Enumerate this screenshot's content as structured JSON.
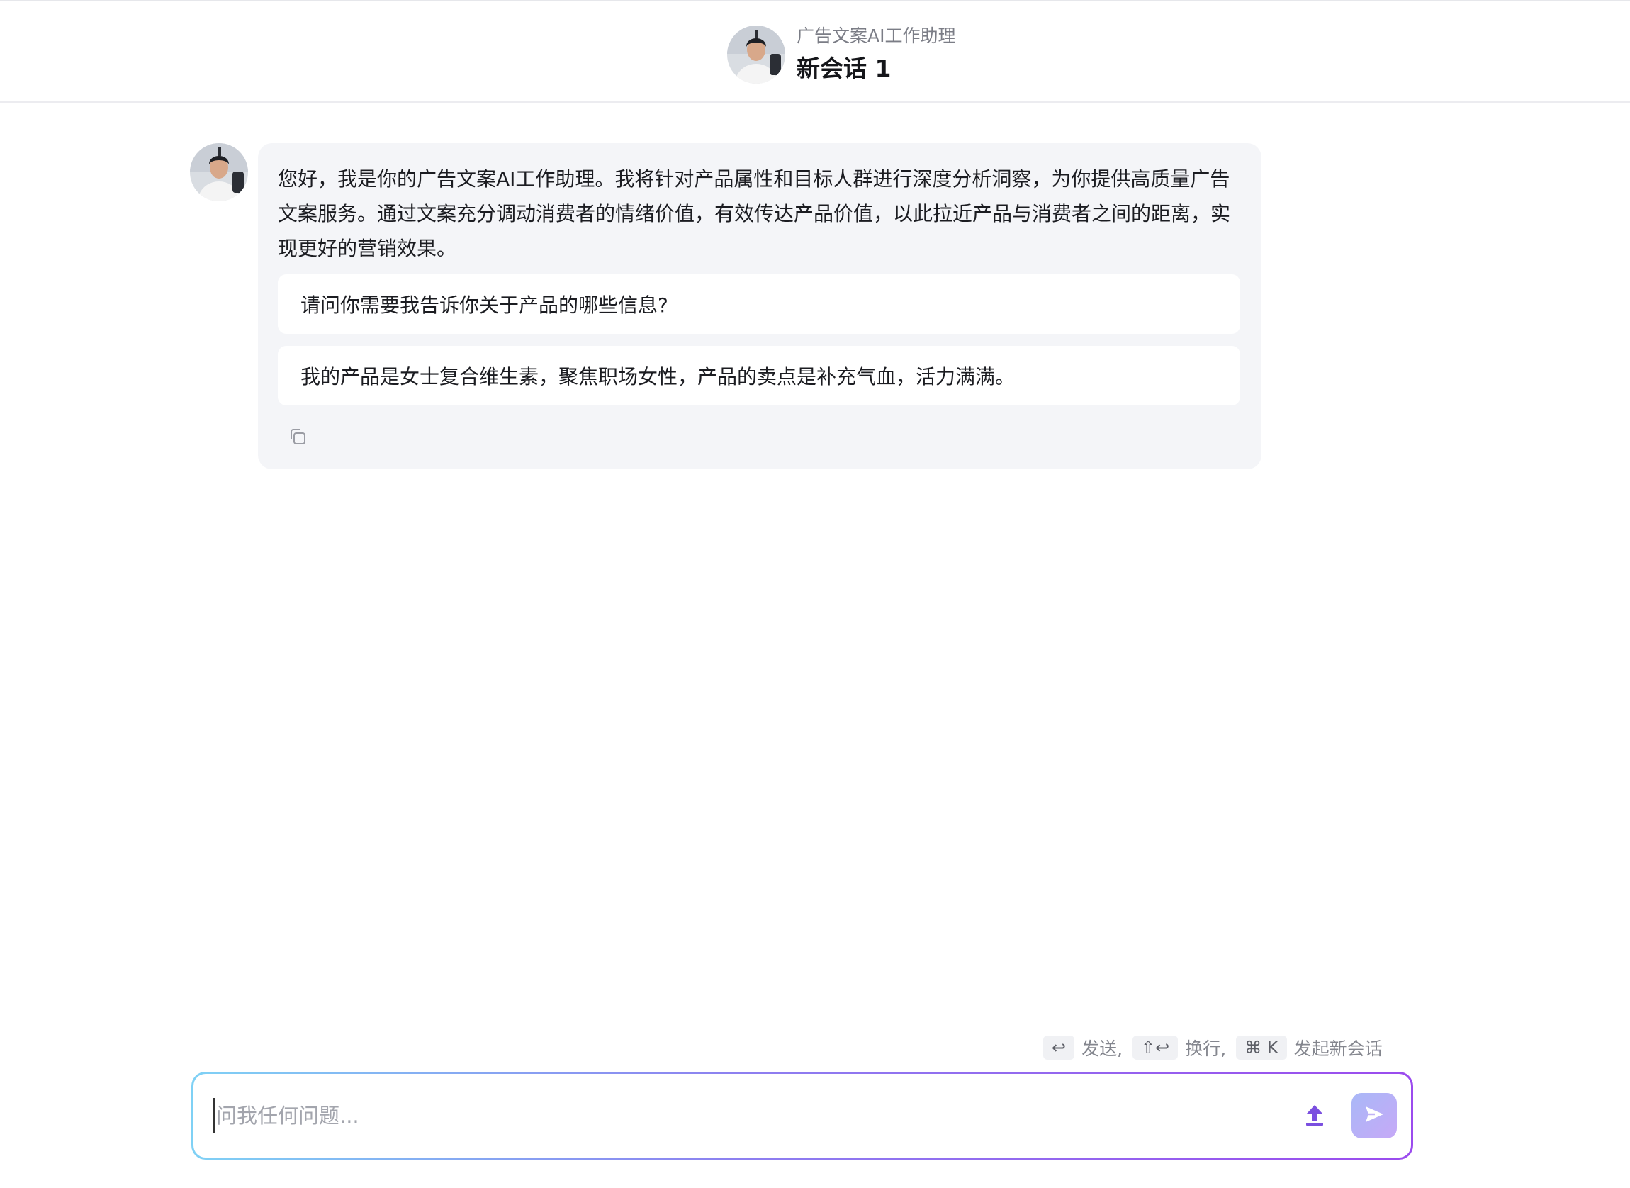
{
  "header": {
    "subtitle": "广告文案AI工作助理",
    "title": "新会话 1"
  },
  "message": {
    "text": "您好，我是你的广告文案AI工作助理。我将针对产品属性和目标人群进行深度分析洞察，为你提供高质量广告文案服务。通过文案充分调动消费者的情绪价值，有效传达产品价值，以此拉近产品与消费者之间的距离，实现更好的营销效果。",
    "suggestions": [
      "请问你需要我告诉你关于产品的哪些信息?",
      "我的产品是女士复合维生素，聚焦职场女性，产品的卖点是补充气血，活力满满。"
    ]
  },
  "hints": {
    "send_key": "↩",
    "send_label": "发送,",
    "newline_key": "⇧↩",
    "newline_label": "换行,",
    "newchat_key": "⌘ K",
    "newchat_label": "发起新会话"
  },
  "input": {
    "placeholder": "问我任何问题...",
    "value": ""
  },
  "colors": {
    "accent": "#7b4fe0",
    "input_gradient_start": "#7fd1f5",
    "input_gradient_end": "#9b4bee",
    "bubble_bg": "#f4f5f8"
  },
  "icons": {
    "copy": "copy-icon",
    "upload": "upload-icon",
    "send": "send-icon"
  }
}
